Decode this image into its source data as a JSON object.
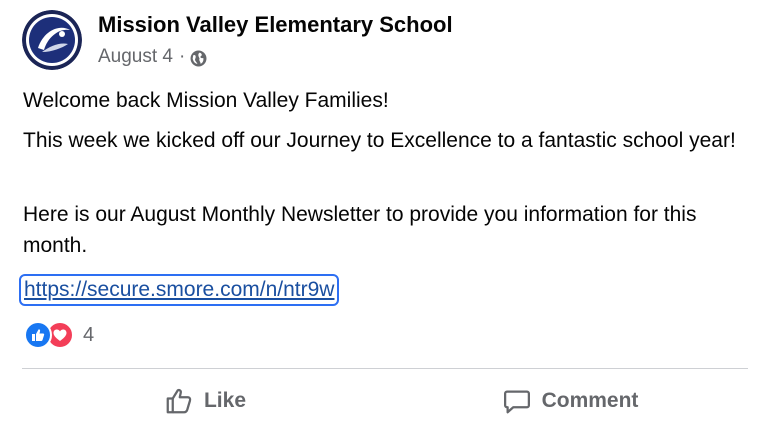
{
  "post": {
    "page_name": "Mission Valley Elementary School",
    "date": "August 4",
    "separator": "·",
    "privacy_icon": "globe-icon",
    "paragraphs": [
      "Welcome back Mission Valley Families!",
      "This week we kicked off our Journey to Excellence to a fantastic school year!",
      "Here is our August Monthly Newsletter to provide you information for this month."
    ],
    "link": "https://secure.smore.com/n/ntr9w"
  },
  "reactions": {
    "icons": [
      "like-reaction-icon",
      "love-reaction-icon"
    ],
    "count": "4"
  },
  "actions": {
    "like_label": "Like",
    "comment_label": "Comment"
  },
  "colors": {
    "like_blue": "#1877f2",
    "love_red": "#f33e58",
    "focus_ring": "#2d6ff3",
    "secondary_text": "#65676b"
  }
}
